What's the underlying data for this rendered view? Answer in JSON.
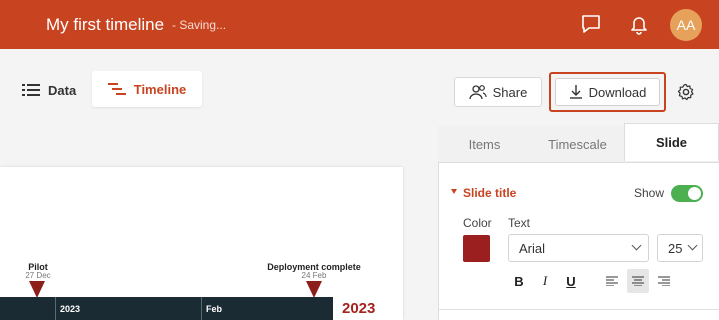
{
  "header": {
    "title": "My first timeline",
    "status": "- Saving...",
    "avatar_initials": "AA",
    "icons": [
      "chat-icon",
      "bell-icon"
    ],
    "brand_color": "#c8431f"
  },
  "toolbar": {
    "data_tab": "Data",
    "timeline_tab": "Timeline",
    "share_label": "Share",
    "download_label": "Download"
  },
  "timeline": {
    "milestones": [
      {
        "label": "Pilot",
        "date": "27 Dec"
      },
      {
        "label": "Deployment complete",
        "date": "24 Feb"
      }
    ],
    "scale": [
      "2023",
      "Feb"
    ],
    "year_label": "2023",
    "marker_color": "#8c1f1a"
  },
  "panel": {
    "tabs": [
      "Items",
      "Timescale",
      "Slide"
    ],
    "active_tab": "Slide",
    "section_title": "Slide title",
    "show_label": "Show",
    "show_enabled": true,
    "color_label": "Color",
    "text_label": "Text",
    "color_value": "#9b1f1f",
    "font_value": "Arial",
    "size_value": "25",
    "format_buttons": [
      "B",
      "I",
      "U"
    ]
  }
}
